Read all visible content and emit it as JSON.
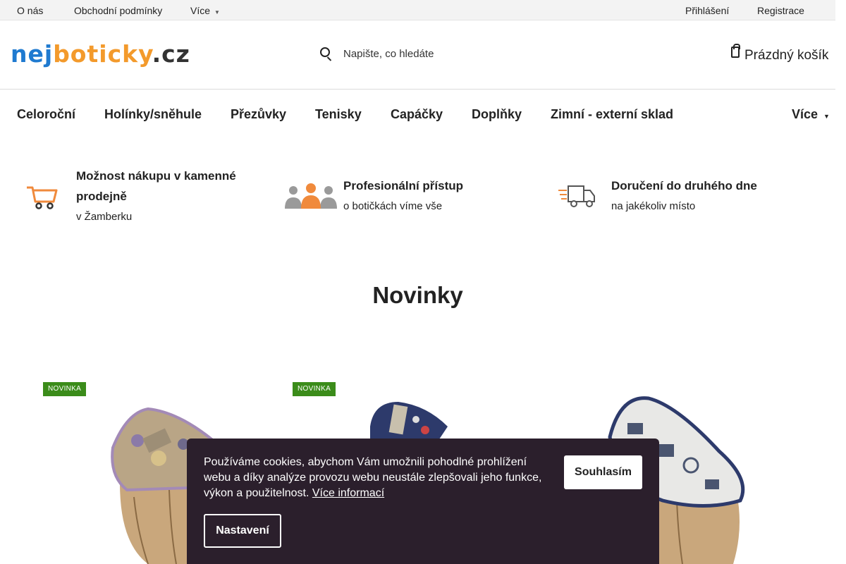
{
  "topbar": {
    "links": [
      "O nás",
      "Obchodní podmínky",
      "Více"
    ],
    "more_caret_icon": "chevron-down-icon",
    "login": "Přihlášení",
    "register": "Registrace"
  },
  "header": {
    "logo": {
      "part1": "nej",
      "part2": "boticky",
      "part3": ".cz"
    },
    "search": {
      "placeholder": "Napište, co hledáte",
      "icon": "search-icon"
    },
    "cart": {
      "label": "Prázdný košík",
      "icon": "shopping-bag-icon"
    }
  },
  "nav": {
    "items": [
      "Celoroční",
      "Holínky/sněhule",
      "Přezůvky",
      "Tenisky",
      "Capáčky",
      "Doplňky",
      "Zimní - externí sklad"
    ],
    "more": "Více"
  },
  "benefits": [
    {
      "icon": "shopping-cart-icon",
      "title": "Možnost nákupu v kamenné prodejně",
      "subtitle": "v Žamberku"
    },
    {
      "icon": "people-group-icon",
      "title": "Profesionální přístup",
      "subtitle": "o botičkách víme vše"
    },
    {
      "icon": "delivery-truck-icon",
      "title": "Doručení do druhého dne",
      "subtitle": "na jakékoliv místo"
    }
  ],
  "section": {
    "title": "Novinky"
  },
  "products": [
    {
      "badge": "NOVINKA",
      "image": "floral-slipper-on-wood-stump"
    },
    {
      "badge": "NOVINKA",
      "image": "navy-slipper-on-wood-stump"
    },
    {
      "badge": "",
      "image": "printed-grey-slipper-on-wood-stump"
    }
  ],
  "cookie": {
    "text": "Používáme cookies, abychom Vám umožnili pohodlné prohlížení webu a díky analýze provozu webu neustále zlepšovali jeho funkce, výkon a použitelnost.",
    "link": "Více informací",
    "accept": "Souhlasím",
    "settings": "Nastavení"
  },
  "colors": {
    "logo_blue": "#1f7ad0",
    "logo_orange": "#f39a2c",
    "badge_green": "#3b8c1a",
    "cookie_bg": "#2b1f2c",
    "icon_orange": "#f08a3c"
  }
}
